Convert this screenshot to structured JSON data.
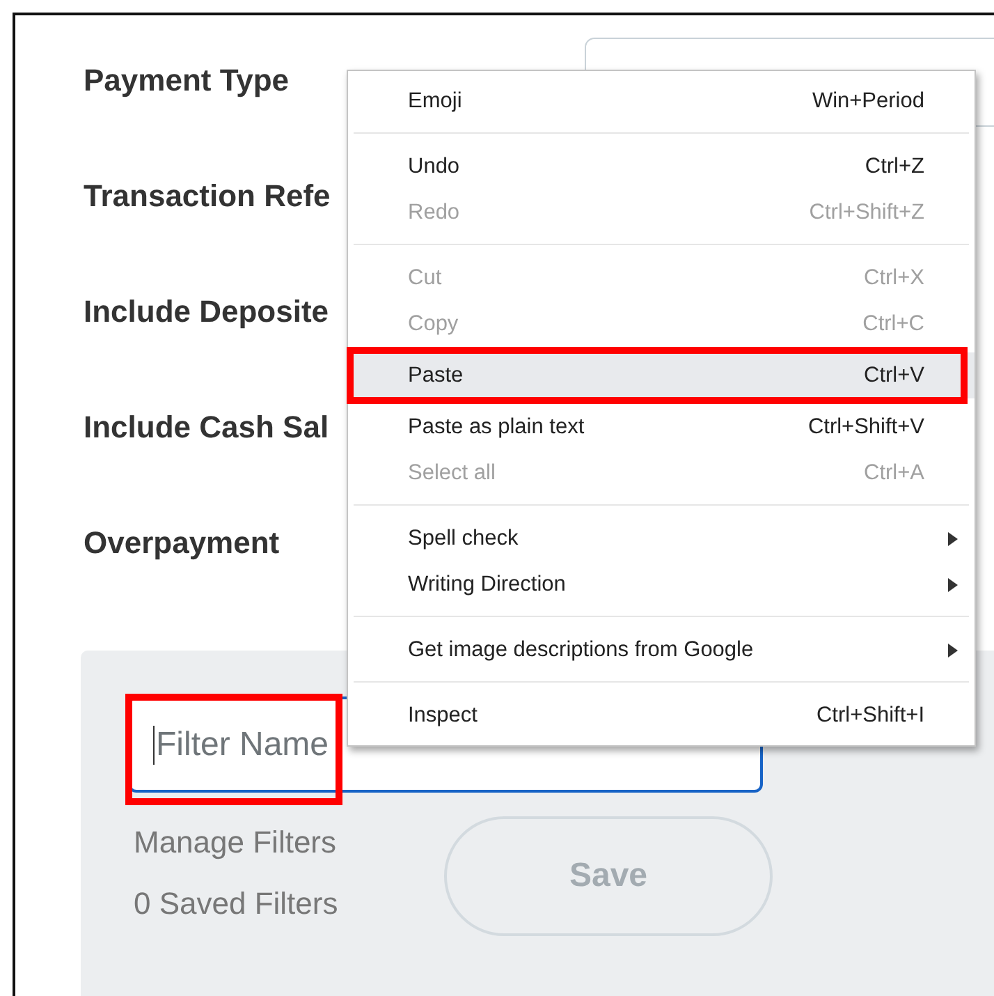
{
  "form": {
    "fields": [
      {
        "label": "Payment Type",
        "has_input": true
      },
      {
        "label": "Transaction Refe",
        "has_input": false
      },
      {
        "label": "Include Deposite",
        "has_input": false
      },
      {
        "label": "Include Cash Sal",
        "has_input": false
      },
      {
        "label": "Overpayment",
        "has_input": false
      }
    ]
  },
  "filter_panel": {
    "filter_name": {
      "placeholder": "Filter Name",
      "focused": true,
      "annotated": true
    },
    "manage_filters": "Manage Filters",
    "saved_filters": "0 Saved Filters",
    "save_button": {
      "label": "Save",
      "disabled": true
    }
  },
  "context_menu": {
    "groups": [
      {
        "items": [
          {
            "label": "Emoji",
            "shortcut": "Win+Period",
            "disabled": false,
            "selected": false,
            "annotated": false,
            "submenu": false
          }
        ]
      },
      {
        "items": [
          {
            "label": "Undo",
            "shortcut": "Ctrl+Z",
            "disabled": false,
            "selected": false,
            "annotated": false,
            "submenu": false
          },
          {
            "label": "Redo",
            "shortcut": "Ctrl+Shift+Z",
            "disabled": true,
            "selected": false,
            "annotated": false,
            "submenu": false
          }
        ]
      },
      {
        "items": [
          {
            "label": "Cut",
            "shortcut": "Ctrl+X",
            "disabled": true,
            "selected": false,
            "annotated": false,
            "submenu": false
          },
          {
            "label": "Copy",
            "shortcut": "Ctrl+C",
            "disabled": true,
            "selected": false,
            "annotated": false,
            "submenu": false
          },
          {
            "label": "Paste",
            "shortcut": "Ctrl+V",
            "disabled": false,
            "selected": true,
            "annotated": true,
            "submenu": false
          },
          {
            "label": "Paste as plain text",
            "shortcut": "Ctrl+Shift+V",
            "disabled": false,
            "selected": false,
            "annotated": false,
            "submenu": false
          },
          {
            "label": "Select all",
            "shortcut": "Ctrl+A",
            "disabled": true,
            "selected": false,
            "annotated": false,
            "submenu": false
          }
        ]
      },
      {
        "items": [
          {
            "label": "Spell check",
            "disabled": false,
            "selected": false,
            "annotated": false,
            "submenu": true
          },
          {
            "label": "Writing Direction",
            "disabled": false,
            "selected": false,
            "annotated": false,
            "submenu": true
          }
        ]
      },
      {
        "items": [
          {
            "label": "Get image descriptions from Google",
            "disabled": false,
            "selected": false,
            "annotated": false,
            "submenu": true
          }
        ]
      },
      {
        "items": [
          {
            "label": "Inspect",
            "shortcut": "Ctrl+Shift+I",
            "disabled": false,
            "selected": false,
            "annotated": false,
            "submenu": false
          }
        ]
      }
    ]
  }
}
